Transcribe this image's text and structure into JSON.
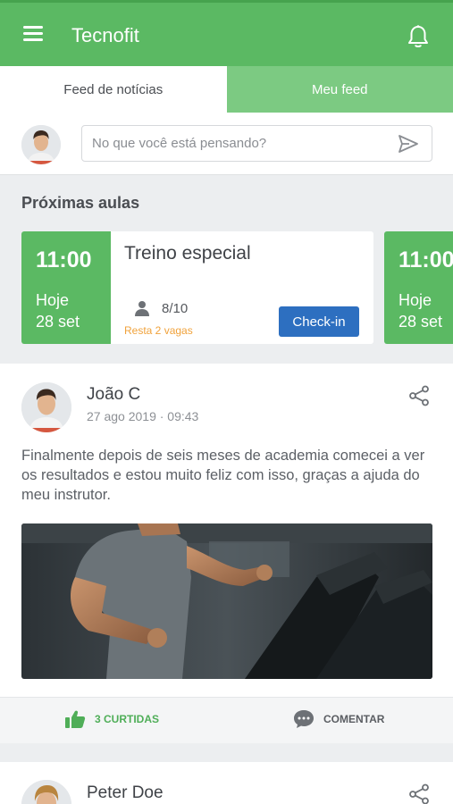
{
  "header": {
    "title": "Tecnofit",
    "menu_icon": "menu-icon",
    "notification_icon": "bell-icon"
  },
  "tabs": [
    {
      "label": "Feed de notícias",
      "active": true
    },
    {
      "label": "Meu feed",
      "active": false
    }
  ],
  "composer": {
    "placeholder": "No que você está pensando?",
    "send_icon": "send-icon"
  },
  "upcoming": {
    "title": "Próximas aulas",
    "classes": [
      {
        "time": "11:00",
        "day": "Hoje",
        "date": "28 set",
        "name": "Treino especial",
        "slots": "8/10",
        "remaining": "Resta 2 vagas",
        "button": "Check-in"
      },
      {
        "time": "11:00",
        "day": "Hoje",
        "date": "28 set"
      }
    ]
  },
  "posts": [
    {
      "author": "João C",
      "timestamp": "27 ago 2019 · 09:43",
      "text": "Finalmente depois de seis meses de academia comecei a ver os resultados e estou muito feliz com isso, graças a ajuda do meu instrutor.",
      "likes_label": "3 CURTIDAS",
      "comment_label": "COMENTAR"
    },
    {
      "author": "Peter Doe"
    }
  ],
  "colors": {
    "primary": "#5bb963",
    "primary_light": "#7cca82",
    "button_blue": "#2d6fc0",
    "warning": "#f0a23b"
  }
}
